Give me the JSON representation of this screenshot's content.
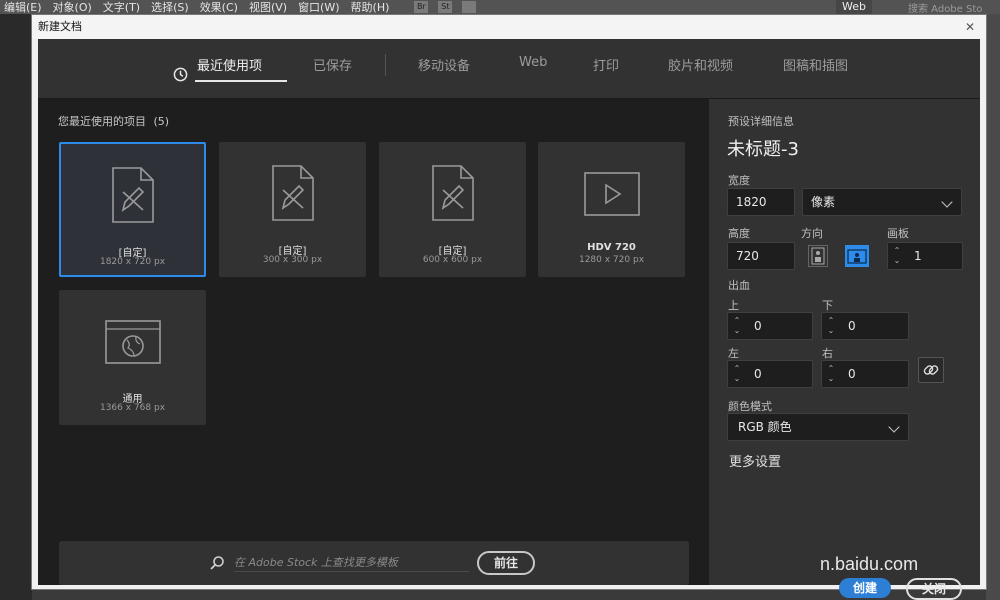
{
  "menubar": {
    "items": [
      "编辑(E)",
      "对象(O)",
      "文字(T)",
      "选择(S)",
      "效果(C)",
      "视图(V)",
      "窗口(W)",
      "帮助(H)"
    ],
    "icons": [
      "Br",
      "St"
    ],
    "workspace": "Web",
    "stock_search_placeholder": "搜索 Adobe Sto"
  },
  "dialog": {
    "title": "新建文档",
    "close": "✕"
  },
  "tabs": [
    {
      "label": "最近使用项",
      "active": true
    },
    {
      "label": "已保存"
    },
    {
      "label": "移动设备"
    },
    {
      "label": "Web"
    },
    {
      "label": "打印"
    },
    {
      "label": "胶片和视频"
    },
    {
      "label": "图稿和插图"
    }
  ],
  "recent": {
    "title": "您最近使用的项目",
    "count": "(5)",
    "items": [
      {
        "name": "[自定]",
        "size": "1820 x 720 px",
        "icon": "document-pencil-icon"
      },
      {
        "name": "[自定]",
        "size": "300 x 300 px",
        "icon": "document-pencil-icon"
      },
      {
        "name": "[自定]",
        "size": "600 x 600 px",
        "icon": "document-pencil-icon"
      },
      {
        "name": "HDV 720",
        "size": "1280 x 720 px",
        "icon": "video-play-icon"
      },
      {
        "name": "通用",
        "size": "1366 x 768 px",
        "icon": "web-globe-icon"
      }
    ]
  },
  "stock": {
    "placeholder": "在 Adobe Stock 上查找更多模板",
    "go_label": "前往"
  },
  "preset": {
    "heading": "预设详细信息",
    "name": "未标题-3",
    "width_label": "宽度",
    "width": "1820",
    "unit": "像素",
    "height_label": "高度",
    "height": "720",
    "orientation_label": "方向",
    "artboards_label": "画板",
    "artboards": "1",
    "bleed_label": "出血",
    "bleed_top_label": "上",
    "bleed_top": "0",
    "bleed_bottom_label": "下",
    "bleed_bottom": "0",
    "bleed_left_label": "左",
    "bleed_left": "0",
    "bleed_right_label": "右",
    "bleed_right": "0",
    "color_mode_label": "颜色模式",
    "color_mode": "RGB 颜色",
    "more_settings": "更多设置",
    "create_label": "创建",
    "close_label": "关闭"
  },
  "watermark": "n.baidu.com"
}
